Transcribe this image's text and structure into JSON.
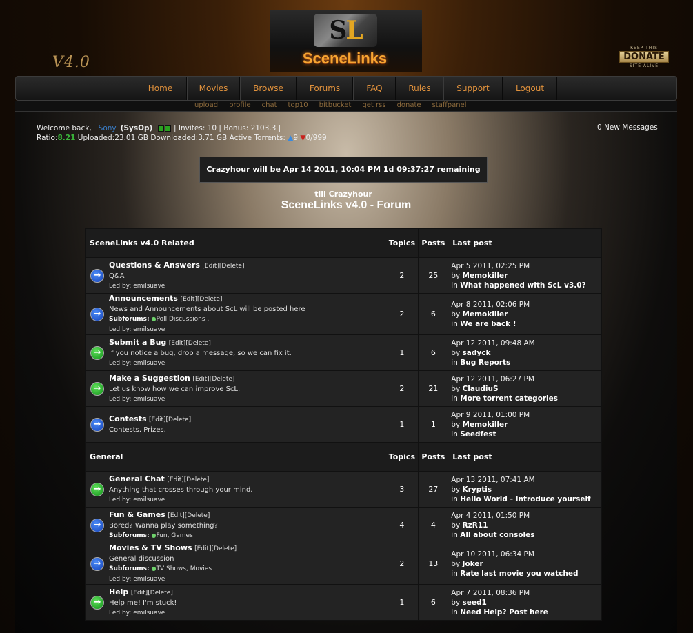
{
  "header": {
    "logo_left": "S",
    "logo_right": "L",
    "site_title": "SceneLinks",
    "version": "V4.0",
    "donate_top": "KEEP THIS",
    "donate_main": "DONATE",
    "donate_bottom": "SITE ALIVE"
  },
  "nav": [
    "Home",
    "Movies",
    "Browse",
    "Forums",
    "FAQ",
    "Rules",
    "Support",
    "Logout"
  ],
  "subnav": [
    "upload",
    "profile",
    "chat",
    "top10",
    "bitbucket",
    "get rss",
    "donate",
    "staffpanel"
  ],
  "user": {
    "welcome": "Welcome back,",
    "name": "Sony",
    "role": "(SysOp)",
    "invites": "| Invites: 10 | Bonus: 2103.3 |",
    "ratio_label": "Ratio:",
    "ratio": "8.21",
    "uploaded": "Uploaded:23.01 GB",
    "downloaded": "Downloaded:3.71 GB",
    "active": "Active Torrents:",
    "seeding": "9",
    "leeching": "0/999",
    "messages": "0 New Messages"
  },
  "countdown": "Crazyhour will be Apr 14 2011, 10:04 PM 1d 09:37:27 remaining till Crazyhour",
  "page_title": "SceneLinks v4.0 - Forum",
  "columns": {
    "topics": "Topics",
    "posts": "Posts",
    "last": "Last post"
  },
  "labels": {
    "edit": "[Edit][Delete]",
    "led_by": "Led by:",
    "subforums": "Subforums:",
    "by": "by",
    "in": "in"
  },
  "categories": [
    {
      "name": "SceneLinks v4.0 Related",
      "forums": [
        {
          "name": "Questions & Answers",
          "desc": "Q&A",
          "leader": "emilsuave",
          "topics": "2",
          "posts": "25",
          "date": "Apr 5 2011, 02:25 PM",
          "user": "Memokiller",
          "topic": "What happened with ScL v3.0?",
          "icon": "blue"
        },
        {
          "name": "Announcements",
          "desc": "News and Announcements about ScL will be posted here",
          "subforums": "Poll Discussions .",
          "leader": "emilsuave",
          "topics": "2",
          "posts": "6",
          "date": "Apr 8 2011, 02:06 PM",
          "user": "Memokiller",
          "topic": "We are back !",
          "icon": "blue"
        },
        {
          "name": "Submit a Bug",
          "desc": "If you notice a bug, drop a message, so we can fix it.",
          "leader": "emilsuave",
          "topics": "1",
          "posts": "6",
          "date": "Apr 12 2011, 09:48 AM",
          "user": "sadyck",
          "topic": "Bug Reports",
          "icon": "green"
        },
        {
          "name": "Make a Suggestion",
          "desc": "Let us know how we can improve ScL.",
          "leader": "emilsuave",
          "topics": "2",
          "posts": "21",
          "date": "Apr 12 2011, 06:27 PM",
          "user": "ClaudiuS",
          "topic": "More torrent categories",
          "icon": "green"
        },
        {
          "name": "Contests",
          "desc": "Contests. Prizes.",
          "topics": "1",
          "posts": "1",
          "date": "Apr 9 2011, 01:00 PM",
          "user": "Memokiller",
          "topic": "Seedfest",
          "icon": "blue"
        }
      ]
    },
    {
      "name": "General",
      "forums": [
        {
          "name": "General Chat",
          "desc": "Anything that crosses through your mind.",
          "leader": "emilsuave",
          "topics": "3",
          "posts": "27",
          "date": "Apr 13 2011, 07:41 AM",
          "user": "Kryptis",
          "topic": "Hello World - Introduce yourself",
          "icon": "green"
        },
        {
          "name": "Fun & Games",
          "desc": "Bored? Wanna play something?",
          "subforums": "Fun,  Games",
          "topics": "4",
          "posts": "4",
          "date": "Apr 4 2011, 01:50 PM",
          "user": "RzR11",
          "topic": "All about consoles",
          "icon": "blue"
        },
        {
          "name": "Movies & TV Shows",
          "desc": "General discussion",
          "subforums": "TV Shows,  Movies",
          "leader": "emilsuave",
          "topics": "2",
          "posts": "13",
          "date": "Apr 10 2011, 06:34 PM",
          "user": "Joker",
          "topic": "Rate last movie you watched",
          "icon": "blue"
        },
        {
          "name": "Help",
          "desc": "Help me! I'm stuck!",
          "leader": "emilsuave",
          "topics": "1",
          "posts": "6",
          "date": "Apr 7 2011, 08:36 PM",
          "user": "seed1",
          "topic": "Need Help? Post here",
          "icon": "green"
        }
      ]
    }
  ]
}
